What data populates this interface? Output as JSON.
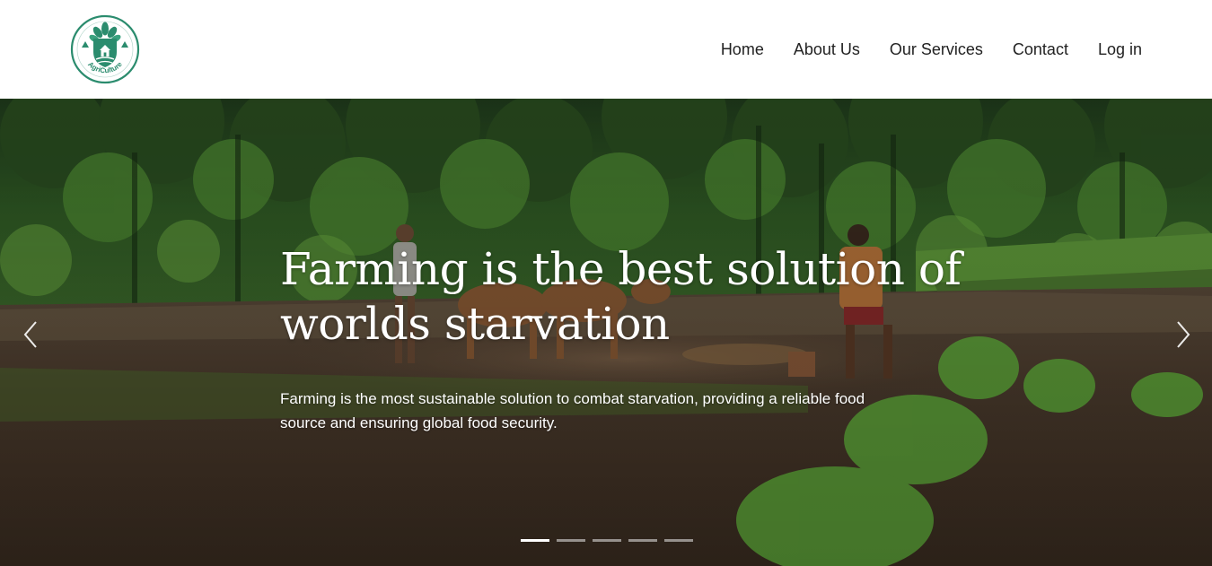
{
  "logo": {
    "text": "AgriCulture",
    "icon": "leaf-house-emblem",
    "color": "#2b8c6e"
  },
  "nav": {
    "items": [
      {
        "label": "Home"
      },
      {
        "label": "About Us"
      },
      {
        "label": "Our Services"
      },
      {
        "label": "Contact"
      },
      {
        "label": "Log in"
      }
    ]
  },
  "hero": {
    "title": "Farming is the best solution of worlds starvation",
    "text": "Farming is the most sustainable solution to combat starvation, providing a reliable food source and ensuring global food security.",
    "prev_icon": "chevron-left-icon",
    "next_icon": "chevron-right-icon",
    "slide_count": 5,
    "active_slide": 1
  }
}
